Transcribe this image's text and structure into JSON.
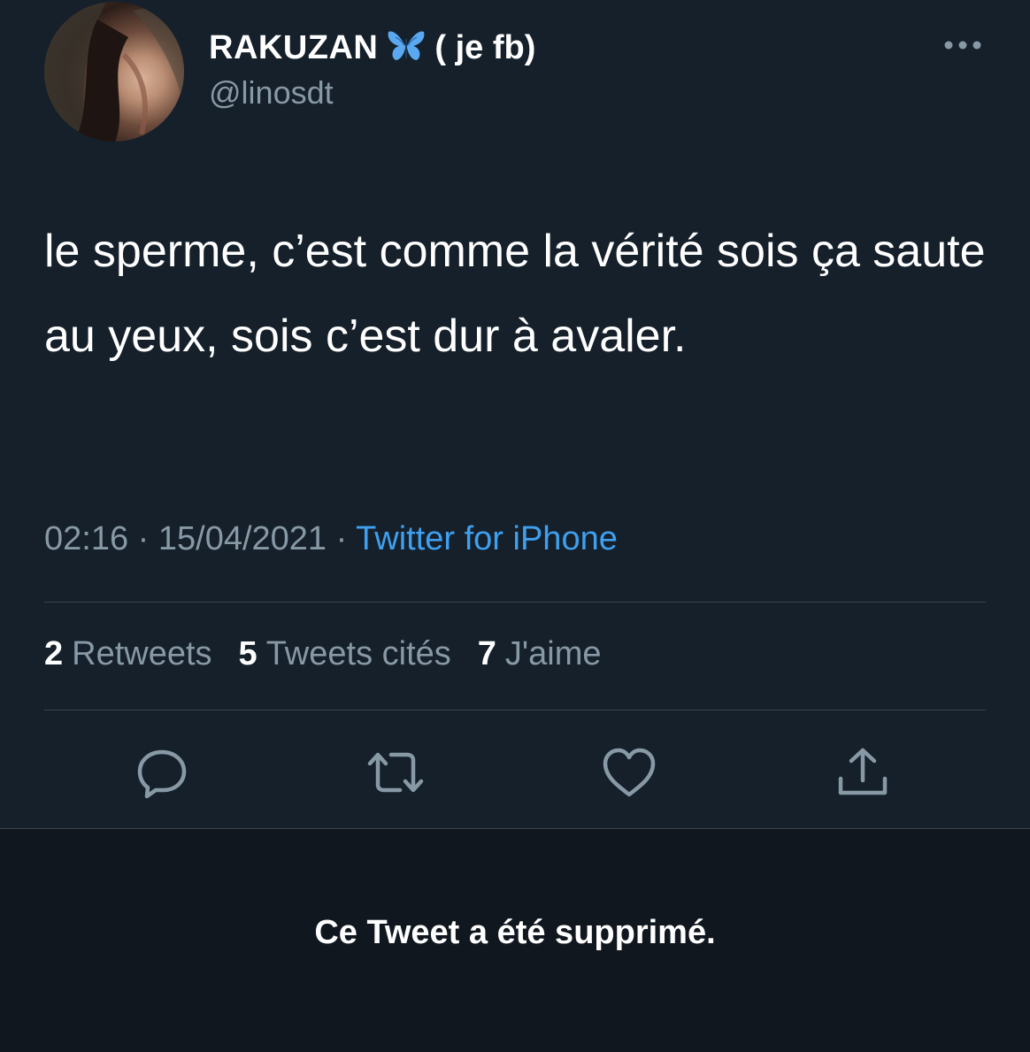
{
  "tweet": {
    "display_name": "RAKUZAN",
    "name_suffix": "( je fb)",
    "handle": "@linosdt",
    "text": "le sperme, c’est comme la vérité sois ça saute au yeux, sois c’est dur à avaler.",
    "time": "02:16",
    "date": "15/04/2021",
    "separator": "·",
    "source": "Twitter for iPhone",
    "stats": {
      "retweets_count": "2",
      "retweets_label": "Retweets",
      "quotes_count": "5",
      "quotes_label": "Tweets cités",
      "likes_count": "7",
      "likes_label": "J'aime"
    }
  },
  "icons": {
    "butterfly": "butterfly-emoji-icon",
    "more": "more-dots-icon",
    "reply": "reply-icon",
    "retweet": "retweet-icon",
    "like": "heart-icon",
    "share": "share-icon"
  },
  "colors": {
    "background": "#15202b",
    "footer_background": "#10171e",
    "secondary_text": "#8899a6",
    "link": "#3fa0ef",
    "divider": "#38444d",
    "butterfly": "#5aa9f0"
  },
  "deleted_notice": "Ce Tweet a été supprimé."
}
